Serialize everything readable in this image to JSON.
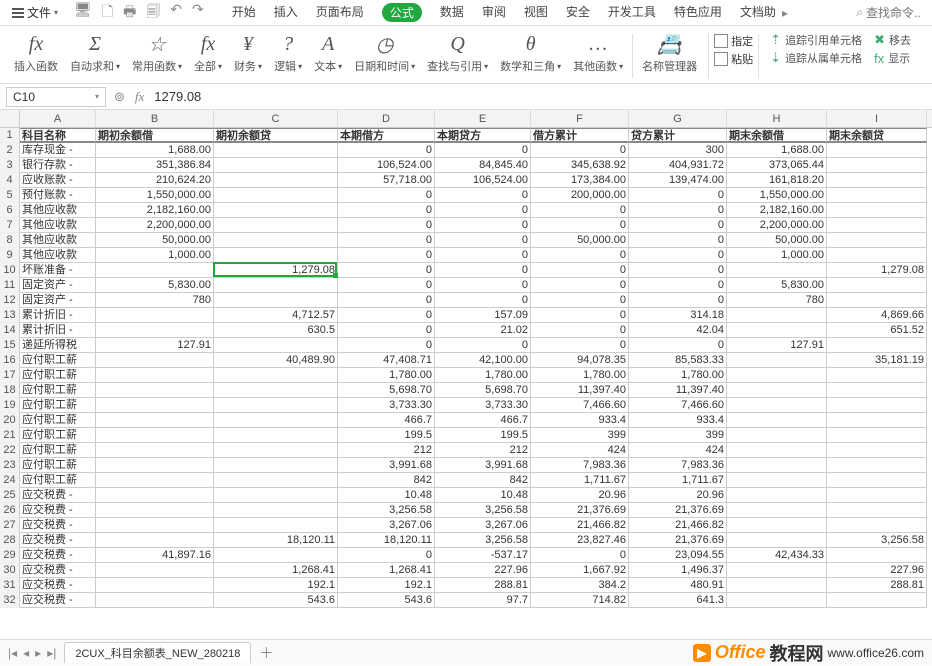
{
  "menu": {
    "file": "文件",
    "tabs": [
      "开始",
      "插入",
      "页面布局",
      "公式",
      "数据",
      "审阅",
      "视图",
      "安全",
      "开发工具",
      "特色应用",
      "文档助"
    ],
    "active_tab": 3,
    "search_placeholder": "查找命令..",
    "search_icon": "⌕"
  },
  "ribbon": {
    "groups": [
      {
        "icon": "fx",
        "label": "插入函数",
        "caret": false
      },
      {
        "icon": "Σ",
        "label": "自动求和",
        "caret": true
      },
      {
        "icon": "☆",
        "label": "常用函数",
        "caret": true
      },
      {
        "icon": "fx",
        "label": "全部",
        "caret": true
      },
      {
        "icon": "¥",
        "label": "财务",
        "caret": true
      },
      {
        "icon": "?",
        "label": "逻辑",
        "caret": true
      },
      {
        "icon": "A",
        "label": "文本",
        "caret": true
      },
      {
        "icon": "◷",
        "label": "日期和时间",
        "caret": true
      },
      {
        "icon": "Q",
        "label": "查找与引用",
        "caret": true
      },
      {
        "icon": "θ",
        "label": "数学和三角",
        "caret": true
      },
      {
        "icon": "…",
        "label": "其他函数",
        "caret": true
      },
      {
        "icon": "📇",
        "label": "名称管理器",
        "caret": false
      }
    ],
    "right_top": {
      "pin": "指定",
      "paste": "粘贴"
    },
    "right_rows": [
      "追踪引用单元格",
      "追踪从属单元格"
    ],
    "right_far": [
      "移去",
      "显示"
    ]
  },
  "fbar": {
    "name": "C10",
    "formula": "1279.08"
  },
  "grid": {
    "cols": [
      "A",
      "B",
      "C",
      "D",
      "E",
      "F",
      "G",
      "H",
      "I"
    ],
    "header": [
      "科目名称",
      "期初余额借",
      "期初余额贷",
      "本期借方",
      "本期贷方",
      "借方累计",
      "贷方累计",
      "期末余额借",
      "期末余额贷"
    ],
    "rows": [
      {
        "r": 2,
        "a": "库存现金 -",
        "b": "1,688.00",
        "c": "",
        "d": "0",
        "e": "0",
        "f": "0",
        "g": "300",
        "h": "1,688.00",
        "i": ""
      },
      {
        "r": 3,
        "a": "银行存款 -",
        "b": "351,386.84",
        "c": "",
        "d": "106,524.00",
        "e": "84,845.40",
        "f": "345,638.92",
        "g": "404,931.72",
        "h": "373,065.44",
        "i": ""
      },
      {
        "r": 4,
        "a": "应收账款 -",
        "b": "210,624.20",
        "c": "",
        "d": "57,718.00",
        "e": "106,524.00",
        "f": "173,384.00",
        "g": "139,474.00",
        "h": "161,818.20",
        "i": ""
      },
      {
        "r": 5,
        "a": "预付账款 -",
        "b": "1,550,000.00",
        "c": "",
        "d": "0",
        "e": "0",
        "f": "200,000.00",
        "g": "0",
        "h": "1,550,000.00",
        "i": ""
      },
      {
        "r": 6,
        "a": "其他应收款",
        "b": "2,182,160.00",
        "c": "",
        "d": "0",
        "e": "0",
        "f": "0",
        "g": "0",
        "h": "2,182,160.00",
        "i": ""
      },
      {
        "r": 7,
        "a": "其他应收款",
        "b": "2,200,000.00",
        "c": "",
        "d": "0",
        "e": "0",
        "f": "0",
        "g": "0",
        "h": "2,200,000.00",
        "i": ""
      },
      {
        "r": 8,
        "a": "其他应收款",
        "b": "50,000.00",
        "c": "",
        "d": "0",
        "e": "0",
        "f": "50,000.00",
        "g": "0",
        "h": "50,000.00",
        "i": ""
      },
      {
        "r": 9,
        "a": "其他应收款",
        "b": "1,000.00",
        "c": "",
        "d": "0",
        "e": "0",
        "f": "0",
        "g": "0",
        "h": "1,000.00",
        "i": ""
      },
      {
        "r": 10,
        "a": "坏账准备 -",
        "b": "",
        "c": "1,279.08",
        "d": "0",
        "e": "0",
        "f": "0",
        "g": "0",
        "h": "",
        "i": "1,279.08"
      },
      {
        "r": 11,
        "a": "固定资产 -",
        "b": "5,830.00",
        "c": "",
        "d": "0",
        "e": "0",
        "f": "0",
        "g": "0",
        "h": "5,830.00",
        "i": ""
      },
      {
        "r": 12,
        "a": "固定资产 -",
        "b": "780",
        "c": "",
        "d": "0",
        "e": "0",
        "f": "0",
        "g": "0",
        "h": "780",
        "i": ""
      },
      {
        "r": 13,
        "a": "累计折旧 -",
        "b": "",
        "c": "4,712.57",
        "d": "0",
        "e": "157.09",
        "f": "0",
        "g": "314.18",
        "h": "",
        "i": "4,869.66"
      },
      {
        "r": 14,
        "a": "累计折旧 -",
        "b": "",
        "c": "630.5",
        "d": "0",
        "e": "21.02",
        "f": "0",
        "g": "42.04",
        "h": "",
        "i": "651.52"
      },
      {
        "r": 15,
        "a": "递延所得税",
        "b": "127.91",
        "c": "",
        "d": "0",
        "e": "0",
        "f": "0",
        "g": "0",
        "h": "127.91",
        "i": ""
      },
      {
        "r": 16,
        "a": "应付职工薪",
        "b": "",
        "c": "40,489.90",
        "d": "47,408.71",
        "e": "42,100.00",
        "f": "94,078.35",
        "g": "85,583.33",
        "h": "",
        "i": "35,181.19"
      },
      {
        "r": 17,
        "a": "应付职工薪",
        "b": "",
        "c": "",
        "d": "1,780.00",
        "e": "1,780.00",
        "f": "1,780.00",
        "g": "1,780.00",
        "h": "",
        "i": ""
      },
      {
        "r": 18,
        "a": "应付职工薪",
        "b": "",
        "c": "",
        "d": "5,698.70",
        "e": "5,698.70",
        "f": "11,397.40",
        "g": "11,397.40",
        "h": "",
        "i": ""
      },
      {
        "r": 19,
        "a": "应付职工薪",
        "b": "",
        "c": "",
        "d": "3,733.30",
        "e": "3,733.30",
        "f": "7,466.60",
        "g": "7,466.60",
        "h": "",
        "i": ""
      },
      {
        "r": 20,
        "a": "应付职工薪",
        "b": "",
        "c": "",
        "d": "466.7",
        "e": "466.7",
        "f": "933.4",
        "g": "933.4",
        "h": "",
        "i": ""
      },
      {
        "r": 21,
        "a": "应付职工薪",
        "b": "",
        "c": "",
        "d": "199.5",
        "e": "199.5",
        "f": "399",
        "g": "399",
        "h": "",
        "i": ""
      },
      {
        "r": 22,
        "a": "应付职工薪",
        "b": "",
        "c": "",
        "d": "212",
        "e": "212",
        "f": "424",
        "g": "424",
        "h": "",
        "i": ""
      },
      {
        "r": 23,
        "a": "应付职工薪",
        "b": "",
        "c": "",
        "d": "3,991.68",
        "e": "3,991.68",
        "f": "7,983.36",
        "g": "7,983.36",
        "h": "",
        "i": ""
      },
      {
        "r": 24,
        "a": "应付职工薪",
        "b": "",
        "c": "",
        "d": "842",
        "e": "842",
        "f": "1,711.67",
        "g": "1,711.67",
        "h": "",
        "i": ""
      },
      {
        "r": 25,
        "a": "应交税费 -",
        "b": "",
        "c": "",
        "d": "10.48",
        "e": "10.48",
        "f": "20.96",
        "g": "20.96",
        "h": "",
        "i": ""
      },
      {
        "r": 26,
        "a": "应交税费 -",
        "b": "",
        "c": "",
        "d": "3,256.58",
        "e": "3,256.58",
        "f": "21,376.69",
        "g": "21,376.69",
        "h": "",
        "i": ""
      },
      {
        "r": 27,
        "a": "应交税费 -",
        "b": "",
        "c": "",
        "d": "3,267.06",
        "e": "3,267.06",
        "f": "21,466.82",
        "g": "21,466.82",
        "h": "",
        "i": ""
      },
      {
        "r": 28,
        "a": "应交税费 -",
        "b": "",
        "c": "18,120.11",
        "d": "18,120.11",
        "e": "3,256.58",
        "f": "23,827.46",
        "g": "21,376.69",
        "h": "",
        "i": "3,256.58"
      },
      {
        "r": 29,
        "a": "应交税费 -",
        "b": "41,897.16",
        "c": "",
        "d": "0",
        "e": "-537.17",
        "f": "0",
        "g": "23,094.55",
        "h": "42,434.33",
        "i": ""
      },
      {
        "r": 30,
        "a": "应交税费 -",
        "b": "",
        "c": "1,268.41",
        "d": "1,268.41",
        "e": "227.96",
        "f": "1,667.92",
        "g": "1,496.37",
        "h": "",
        "i": "227.96"
      },
      {
        "r": 31,
        "a": "应交税费 -",
        "b": "",
        "c": "192.1",
        "d": "192.1",
        "e": "288.81",
        "f": "384.2",
        "g": "480.91",
        "h": "",
        "i": "288.81"
      },
      {
        "r": 32,
        "a": "应交税费 -",
        "b": "",
        "c": "543.6",
        "d": "543.6",
        "e": "97.7",
        "f": "714.82",
        "g": "641.3",
        "h": "",
        "i": ""
      }
    ]
  },
  "sheetbar": {
    "tab": "2CUX_科目余额表_NEW_280218",
    "watermark_brand": "Office",
    "watermark_suffix": "教程网",
    "watermark_url": "www.office26.com"
  }
}
